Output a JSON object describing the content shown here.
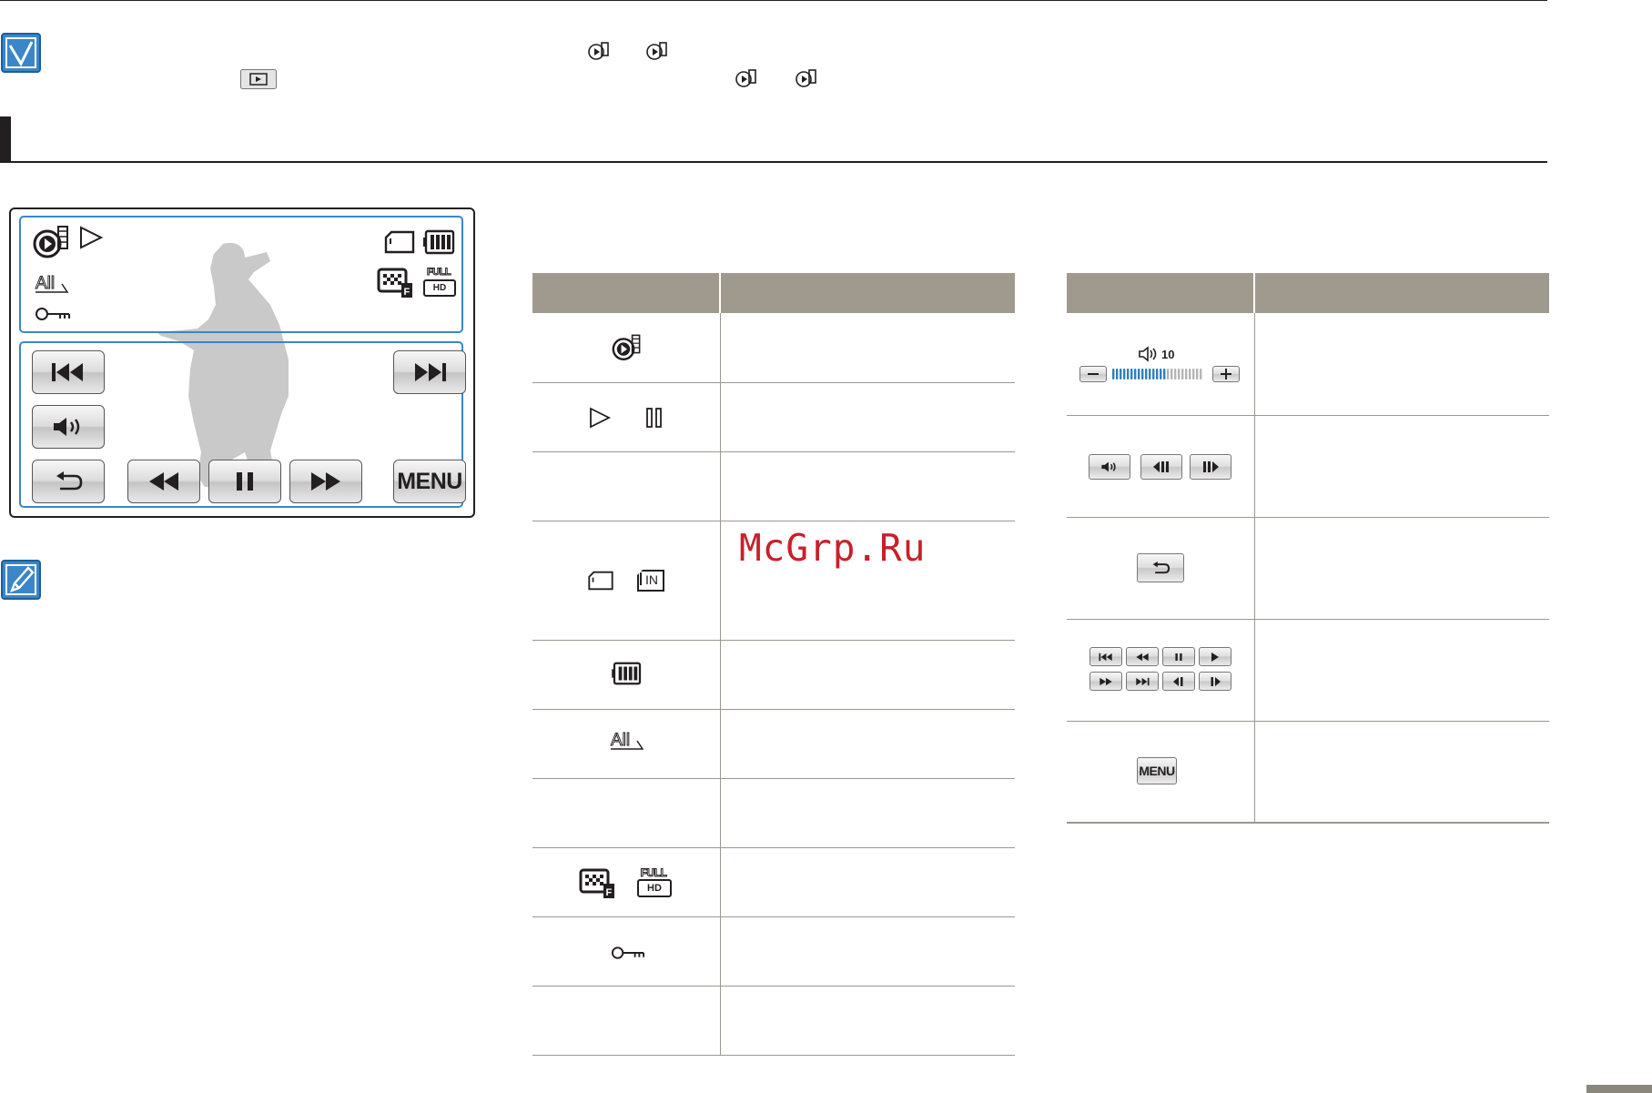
{
  "watermark": "McGrp.Ru",
  "screen": {
    "top_icons": [
      "playback-mode-icon",
      "play-icon",
      "storage-card-icon",
      "battery-icon"
    ],
    "mid_left_text": "All",
    "mid_right_icons": [
      "image-quality-icon",
      "full-hd-icon"
    ],
    "full_hd_top": "FULL",
    "full_hd_bottom": "HD",
    "lower_icons": [
      "protect-key-icon"
    ],
    "buttons": {
      "menu": "MENU"
    }
  },
  "left_table": {
    "rows": [
      {
        "icons": [
          "playback-mode-icon"
        ]
      },
      {
        "icons": [
          "play-icon",
          "pause-icon"
        ]
      },
      {
        "icons": []
      },
      {
        "icons": [
          "storage-card-icon",
          "internal-memory-icon"
        ],
        "internal_label": "IN"
      },
      {
        "icons": [
          "battery-icon"
        ]
      },
      {
        "icons": [
          "all-icon"
        ],
        "all_label": "All"
      },
      {
        "icons": []
      },
      {
        "icons": [
          "image-quality-icon",
          "full-hd-icon"
        ],
        "full_top": "FULL",
        "full_bottom": "HD"
      },
      {
        "icons": [
          "protect-key-icon"
        ]
      },
      {
        "icons": []
      }
    ]
  },
  "right_table": {
    "volume_level": "10",
    "volume_fraction": 0.6,
    "rows": [
      {
        "icons": [
          "volume-speaker-icon",
          "minus-icon",
          "plus-icon"
        ]
      },
      {
        "icons": [
          "volume-button-icon",
          "slow-rewind-icon",
          "slow-forward-icon"
        ]
      },
      {
        "icons": [
          "return-icon"
        ]
      },
      {
        "icons": [
          "skip-back-icon",
          "rewind-icon",
          "pause-icon",
          "play-icon",
          "fast-forward-icon",
          "skip-forward-icon",
          "frame-back-icon",
          "frame-forward-icon"
        ]
      },
      {
        "icons": [
          "menu-button"
        ],
        "menu_label": "MENU"
      }
    ]
  }
}
